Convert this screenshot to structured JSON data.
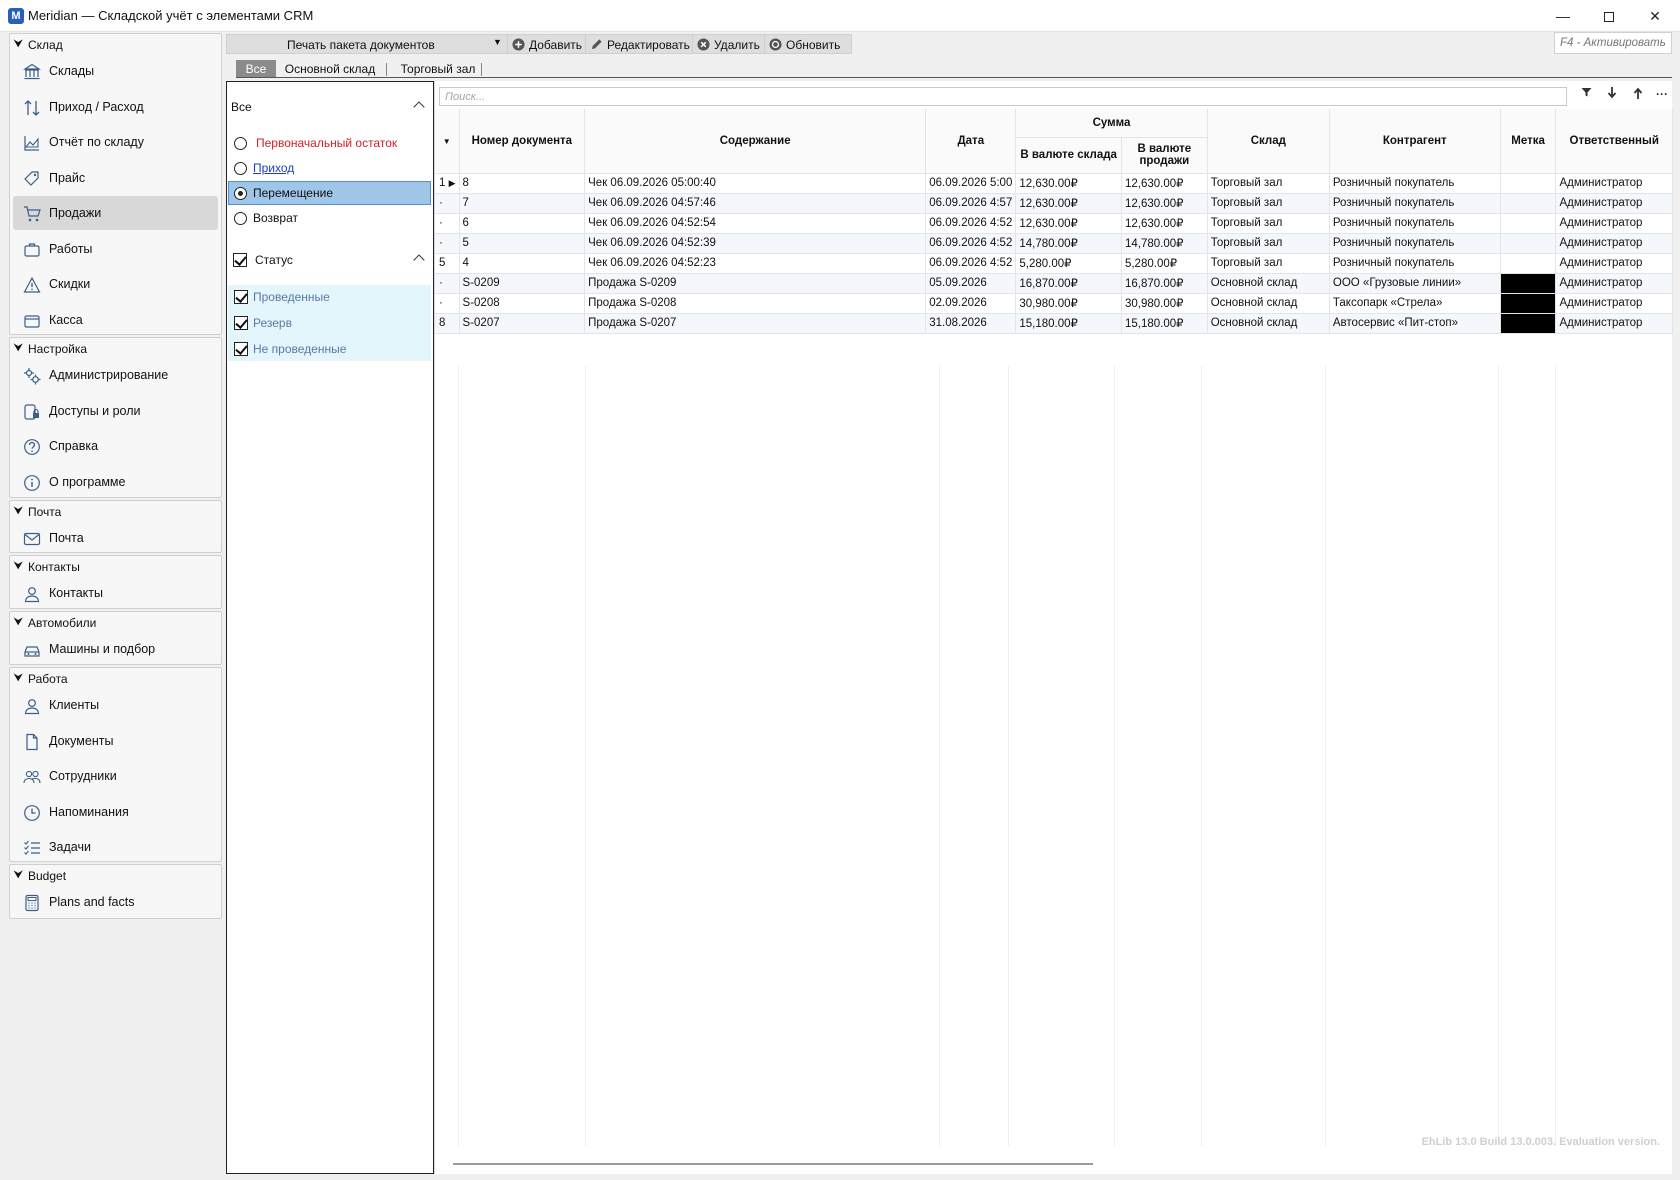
{
  "window": {
    "title": "Meridian — Складской учёт с элементами CRM",
    "logo_letter": "M",
    "minimize": "—",
    "close": "✕"
  },
  "sidebar": {
    "groups": [
      {
        "title": "Склад",
        "items": [
          {
            "label": "Склады",
            "icon": "bank-icon"
          },
          {
            "label": "Приход / Расход",
            "icon": "arrows-updown-icon"
          },
          {
            "label": "Отчёт по складу",
            "icon": "area-chart-icon"
          },
          {
            "label": "Прайс",
            "icon": "price-tag-icon"
          },
          {
            "label": "Продажи",
            "icon": "cart-icon",
            "active": true
          },
          {
            "label": "Работы",
            "icon": "briefcase-icon"
          },
          {
            "label": "Скидки",
            "icon": "warning-icon"
          },
          {
            "label": "Касса",
            "icon": "cashbox-icon"
          }
        ]
      },
      {
        "title": "Настройка",
        "items": [
          {
            "label": "Администрирование",
            "icon": "gears-icon"
          },
          {
            "label": "Доступы и роли",
            "icon": "user-lock-icon"
          },
          {
            "label": "Справка",
            "icon": "help-icon"
          },
          {
            "label": "О программе",
            "icon": "info-icon"
          }
        ]
      },
      {
        "title": "Почта",
        "items": [
          {
            "label": "Почта",
            "icon": "mail-icon"
          }
        ]
      },
      {
        "title": "Контакты",
        "items": [
          {
            "label": "Контакты",
            "icon": "person-icon"
          }
        ]
      },
      {
        "title": "Автомобили",
        "items": [
          {
            "label": "Машины и подбор",
            "icon": "car-icon"
          }
        ]
      },
      {
        "title": "Работа",
        "items": [
          {
            "label": "Клиенты",
            "icon": "person-icon"
          },
          {
            "label": "Документы",
            "icon": "document-icon"
          },
          {
            "label": "Сотрудники",
            "icon": "people-icon"
          },
          {
            "label": "Напоминания",
            "icon": "clock-icon"
          },
          {
            "label": "Задачи",
            "icon": "tasks-icon"
          }
        ]
      },
      {
        "title": "Budget",
        "items": [
          {
            "label": "Plans and facts",
            "icon": "calculator-icon"
          }
        ]
      }
    ]
  },
  "toolbar": {
    "print_label": "Печать пакета документов",
    "add_label": "Добавить",
    "edit_label": "Редактировать",
    "delete_label": "Удалить",
    "refresh_label": "Обновить",
    "activate_placeholder": "F4 - Активировать"
  },
  "tabs": [
    "Все",
    "Основной склад",
    "Торговый зал"
  ],
  "filter": {
    "section1_title": "Все",
    "options": [
      {
        "label": "Первоначальный остаток",
        "style": "red"
      },
      {
        "label": "Приход",
        "style": "link"
      },
      {
        "label": "Перемещение",
        "style": "normal",
        "selected": true
      },
      {
        "label": "Возврат",
        "style": "normal"
      }
    ],
    "section2_title": "Статус",
    "statuses": [
      "Проведенные",
      "Резерв",
      "Не проведенные"
    ]
  },
  "grid": {
    "search_placeholder": "Поиск...",
    "columns": {
      "number": "Номер документа",
      "content": "Содержание",
      "date": "Дата",
      "sum_group": "Сумма",
      "sum_store": "В валюте склада",
      "sum_sale": "В валюте продажи",
      "store": "Склад",
      "counterparty": "Контрагент",
      "mark": "Метка",
      "responsible": "Ответственный"
    },
    "rows": [
      {
        "ind": "1",
        "num": "8",
        "content": "Чек 06.09.2026 05:00:40",
        "date": "06.09.2026 5:00",
        "sum_store": "12,630.00₽",
        "sum_sale": "12,630.00₽",
        "store": "Торговый зал",
        "counterparty": "Розничный покупатель",
        "mark": "",
        "responsible": "Администратор",
        "current": true
      },
      {
        "ind": "·",
        "num": "7",
        "content": "Чек 06.09.2026 04:57:46",
        "date": "06.09.2026 4:57",
        "sum_store": "12,630.00₽",
        "sum_sale": "12,630.00₽",
        "store": "Торговый зал",
        "counterparty": "Розничный покупатель",
        "mark": "",
        "responsible": "Администратор"
      },
      {
        "ind": "·",
        "num": "6",
        "content": "Чек 06.09.2026 04:52:54",
        "date": "06.09.2026 4:52",
        "sum_store": "12,630.00₽",
        "sum_sale": "12,630.00₽",
        "store": "Торговый зал",
        "counterparty": "Розничный покупатель",
        "mark": "",
        "responsible": "Администратор"
      },
      {
        "ind": "·",
        "num": "5",
        "content": "Чек 06.09.2026 04:52:39",
        "date": "06.09.2026 4:52",
        "sum_store": "14,780.00₽",
        "sum_sale": "14,780.00₽",
        "store": "Торговый зал",
        "counterparty": "Розничный покупатель",
        "mark": "",
        "responsible": "Администратор"
      },
      {
        "ind": "5",
        "num": "4",
        "content": "Чек 06.09.2026 04:52:23",
        "date": "06.09.2026 4:52",
        "sum_store": "5,280.00₽",
        "sum_sale": "5,280.00₽",
        "store": "Торговый зал",
        "counterparty": "Розничный покупатель",
        "mark": "",
        "responsible": "Администратор"
      },
      {
        "ind": "·",
        "num": "S-0209",
        "content": "Продажа S-0209",
        "date": "05.09.2026",
        "sum_store": "16,870.00₽",
        "sum_sale": "16,870.00₽",
        "store": "Основной склад",
        "counterparty": "ООО «Грузовые линии»",
        "mark": "black",
        "responsible": "Администратор"
      },
      {
        "ind": "·",
        "num": "S-0208",
        "content": "Продажа S-0208",
        "date": "02.09.2026",
        "sum_store": "30,980.00₽",
        "sum_sale": "30,980.00₽",
        "store": "Основной склад",
        "counterparty": "Таксопарк «Стрела»",
        "mark": "black",
        "responsible": "Администратор"
      },
      {
        "ind": "8",
        "num": "S-0207",
        "content": "Продажа S-0207",
        "date": "31.08.2026",
        "sum_store": "15,180.00₽",
        "sum_sale": "15,180.00₽",
        "store": "Основной склад",
        "counterparty": "Автосервис «Пит-стоп»",
        "mark": "black",
        "responsible": "Администратор"
      }
    ]
  },
  "footer": {
    "evaluation": "EhLib 13.0 Build 13.0.003. Evaluation version."
  }
}
